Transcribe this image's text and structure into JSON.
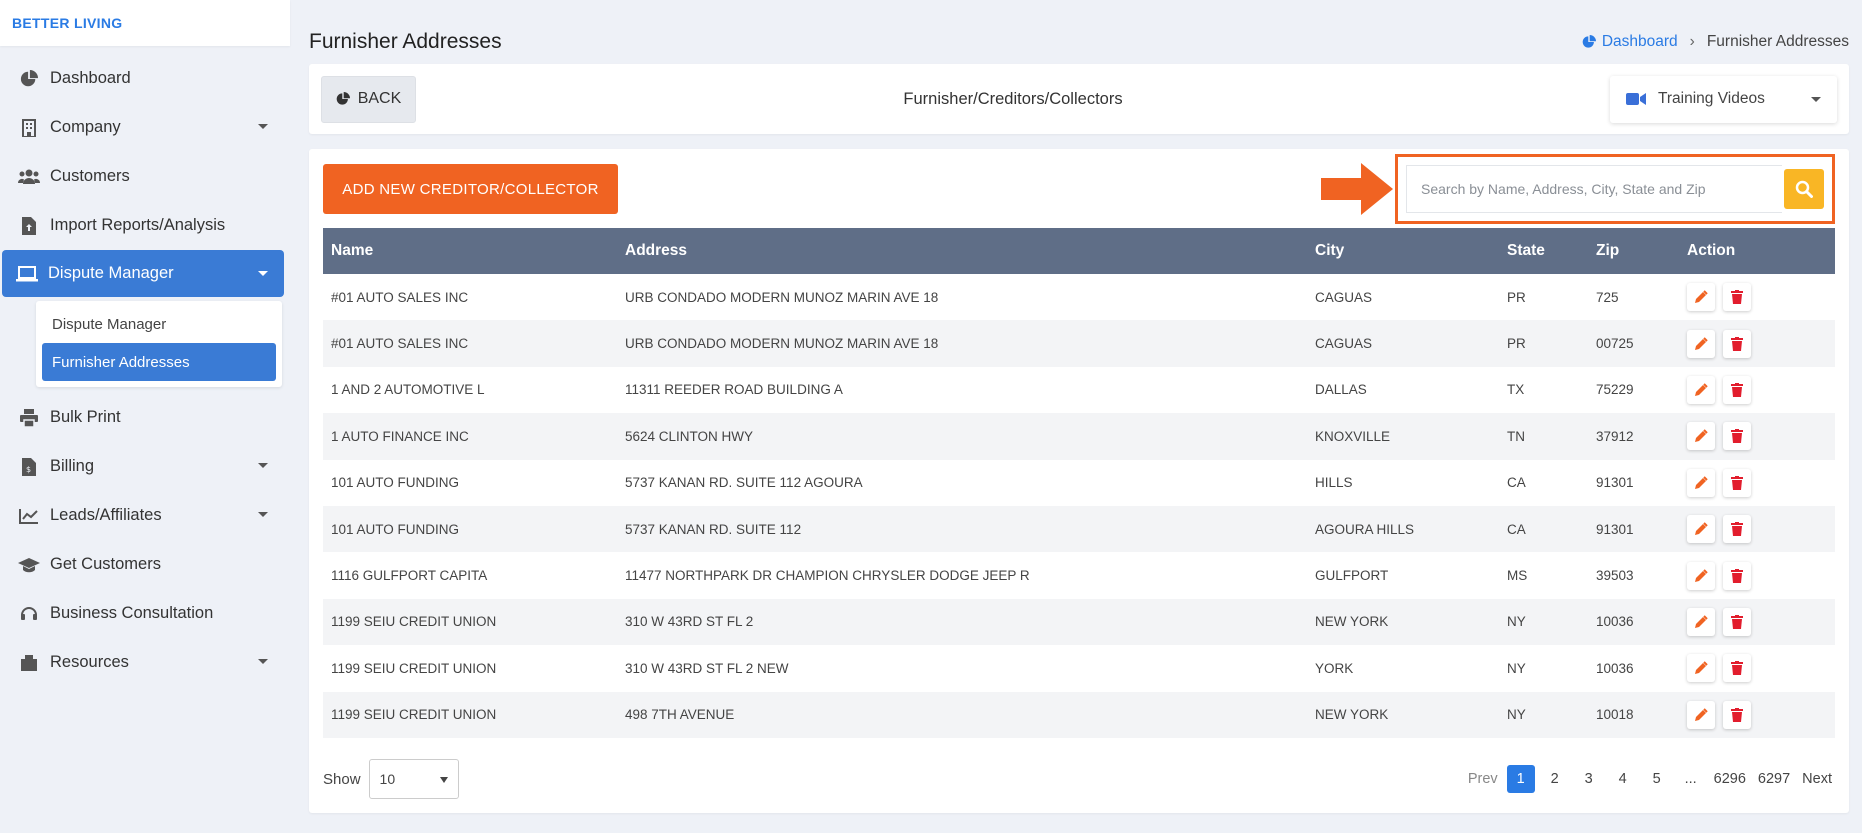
{
  "brand": "BETTER LIVING",
  "sidebar": {
    "items": [
      {
        "label": "Dashboard"
      },
      {
        "label": "Company"
      },
      {
        "label": "Customers"
      },
      {
        "label": "Import Reports/Analysis"
      },
      {
        "label": "Dispute Manager"
      },
      {
        "label": "Bulk Print"
      },
      {
        "label": "Billing"
      },
      {
        "label": "Leads/Affiliates"
      },
      {
        "label": "Get Customers"
      },
      {
        "label": "Business Consultation"
      },
      {
        "label": "Resources"
      }
    ],
    "submenu": [
      {
        "label": "Dispute Manager"
      },
      {
        "label": "Furnisher Addresses"
      }
    ]
  },
  "page": {
    "title": "Furnisher Addresses",
    "breadcrumb_home": "Dashboard",
    "breadcrumb_current": "Furnisher Addresses"
  },
  "toolbar": {
    "back_label": "BACK",
    "title": "Furnisher/Creditors/Collectors",
    "training_label": "Training Videos"
  },
  "actions": {
    "add_label": "ADD NEW CREDITOR/COLLECTOR",
    "search_placeholder": "Search by Name, Address, City, State and Zip"
  },
  "table": {
    "headers": [
      "Name",
      "Address",
      "City",
      "State",
      "Zip",
      "Action"
    ],
    "rows": [
      [
        "#01 AUTO SALES INC",
        "URB CONDADO MODERN MUNOZ MARIN AVE 18",
        "CAGUAS",
        "PR",
        "725"
      ],
      [
        "#01 AUTO SALES INC",
        "URB CONDADO MODERN MUNOZ MARIN AVE 18",
        "CAGUAS",
        "PR",
        "00725"
      ],
      [
        "1 AND 2 AUTOMOTIVE L",
        "11311 REEDER ROAD BUILDING A",
        "DALLAS",
        "TX",
        "75229"
      ],
      [
        "1 AUTO FINANCE INC",
        "5624 CLINTON HWY",
        "KNOXVILLE",
        "TN",
        "37912"
      ],
      [
        "101 AUTO FUNDING",
        "5737 KANAN RD. SUITE 112 AGOURA",
        "HILLS",
        "CA",
        "91301"
      ],
      [
        "101 AUTO FUNDING",
        "5737 KANAN RD. SUITE 112",
        "AGOURA HILLS",
        "CA",
        "91301"
      ],
      [
        "1116 GULFPORT CAPITA",
        "11477 NORTHPARK DR CHAMPION CHRYSLER DODGE JEEP R",
        "GULFPORT",
        "MS",
        "39503"
      ],
      [
        "1199 SEIU CREDIT UNION",
        "310 W 43RD ST FL 2",
        "NEW YORK",
        "NY",
        "10036"
      ],
      [
        "1199 SEIU CREDIT UNION",
        "310 W 43RD ST FL 2 NEW",
        "YORK",
        "NY",
        "10036"
      ],
      [
        "1199 SEIU CREDIT UNION",
        "498 7TH AVENUE",
        "NEW YORK",
        "NY",
        "10018"
      ]
    ]
  },
  "footer": {
    "show_label": "Show",
    "page_size": "10",
    "pager": [
      "Prev",
      "1",
      "2",
      "3",
      "4",
      "5",
      "...",
      "6296",
      "6297",
      "Next"
    ]
  },
  "colors": {
    "accent_blue": "#3a7bd5",
    "accent_orange": "#f06322",
    "search_yellow": "#f9b625",
    "table_header": "#5f6e87"
  }
}
